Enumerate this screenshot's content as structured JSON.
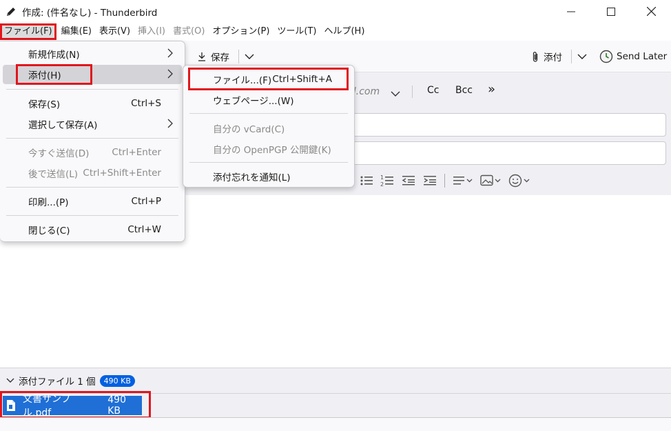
{
  "window": {
    "title": "作成: (件名なし) - Thunderbird"
  },
  "menubar": {
    "items": [
      {
        "label": "ファイル(F)"
      },
      {
        "label": "編集(E)"
      },
      {
        "label": "表示(V)"
      },
      {
        "label": "挿入(I)",
        "disabled": true
      },
      {
        "label": "書式(O)",
        "disabled": true
      },
      {
        "label": "オプション(P)"
      },
      {
        "label": "ツール(T)"
      },
      {
        "label": "ヘルプ(H)"
      }
    ]
  },
  "toolbar": {
    "save_label": "保存",
    "attach_label": "添付",
    "send_later_label": "Send Later"
  },
  "header": {
    "from_partial": "il.com",
    "cc_label": "Cc",
    "bcc_label": "Bcc",
    "more_label": "»"
  },
  "file_menu": {
    "items": [
      {
        "label": "新規作成(N)",
        "submenu": true
      },
      {
        "label": "添付(H)",
        "submenu": true,
        "active": true
      },
      {
        "label": "保存(S)",
        "accel": "Ctrl+S"
      },
      {
        "label": "選択して保存(A)",
        "submenu": true
      },
      {
        "label": "今すぐ送信(D)",
        "accel": "Ctrl+Enter",
        "disabled": true
      },
      {
        "label": "後で送信(L)",
        "accel": "Ctrl+Shift+Enter",
        "disabled": true
      },
      {
        "label": "印刷...(P)",
        "accel": "Ctrl+P"
      },
      {
        "label": "閉じる(C)",
        "accel": "Ctrl+W"
      }
    ]
  },
  "attach_submenu": {
    "items": [
      {
        "label": "ファイル...(F)",
        "accel": "Ctrl+Shift+A"
      },
      {
        "label": "ウェブページ...(W)"
      },
      {
        "label": "自分の vCard(C)",
        "disabled": true
      },
      {
        "label": "自分の OpenPGP 公開鍵(K)",
        "disabled": true
      },
      {
        "label": "添付忘れを通知(L)"
      }
    ]
  },
  "attachments": {
    "header_label": "添付ファイル 1 個",
    "total_size": "490 KB",
    "files": [
      {
        "name": "文書サンプル.pdf",
        "size": "490 KB"
      }
    ]
  },
  "colors": {
    "highlight": "#e0161d",
    "accent": "#0061e0",
    "attachment_selected": "#1f6fd6"
  }
}
